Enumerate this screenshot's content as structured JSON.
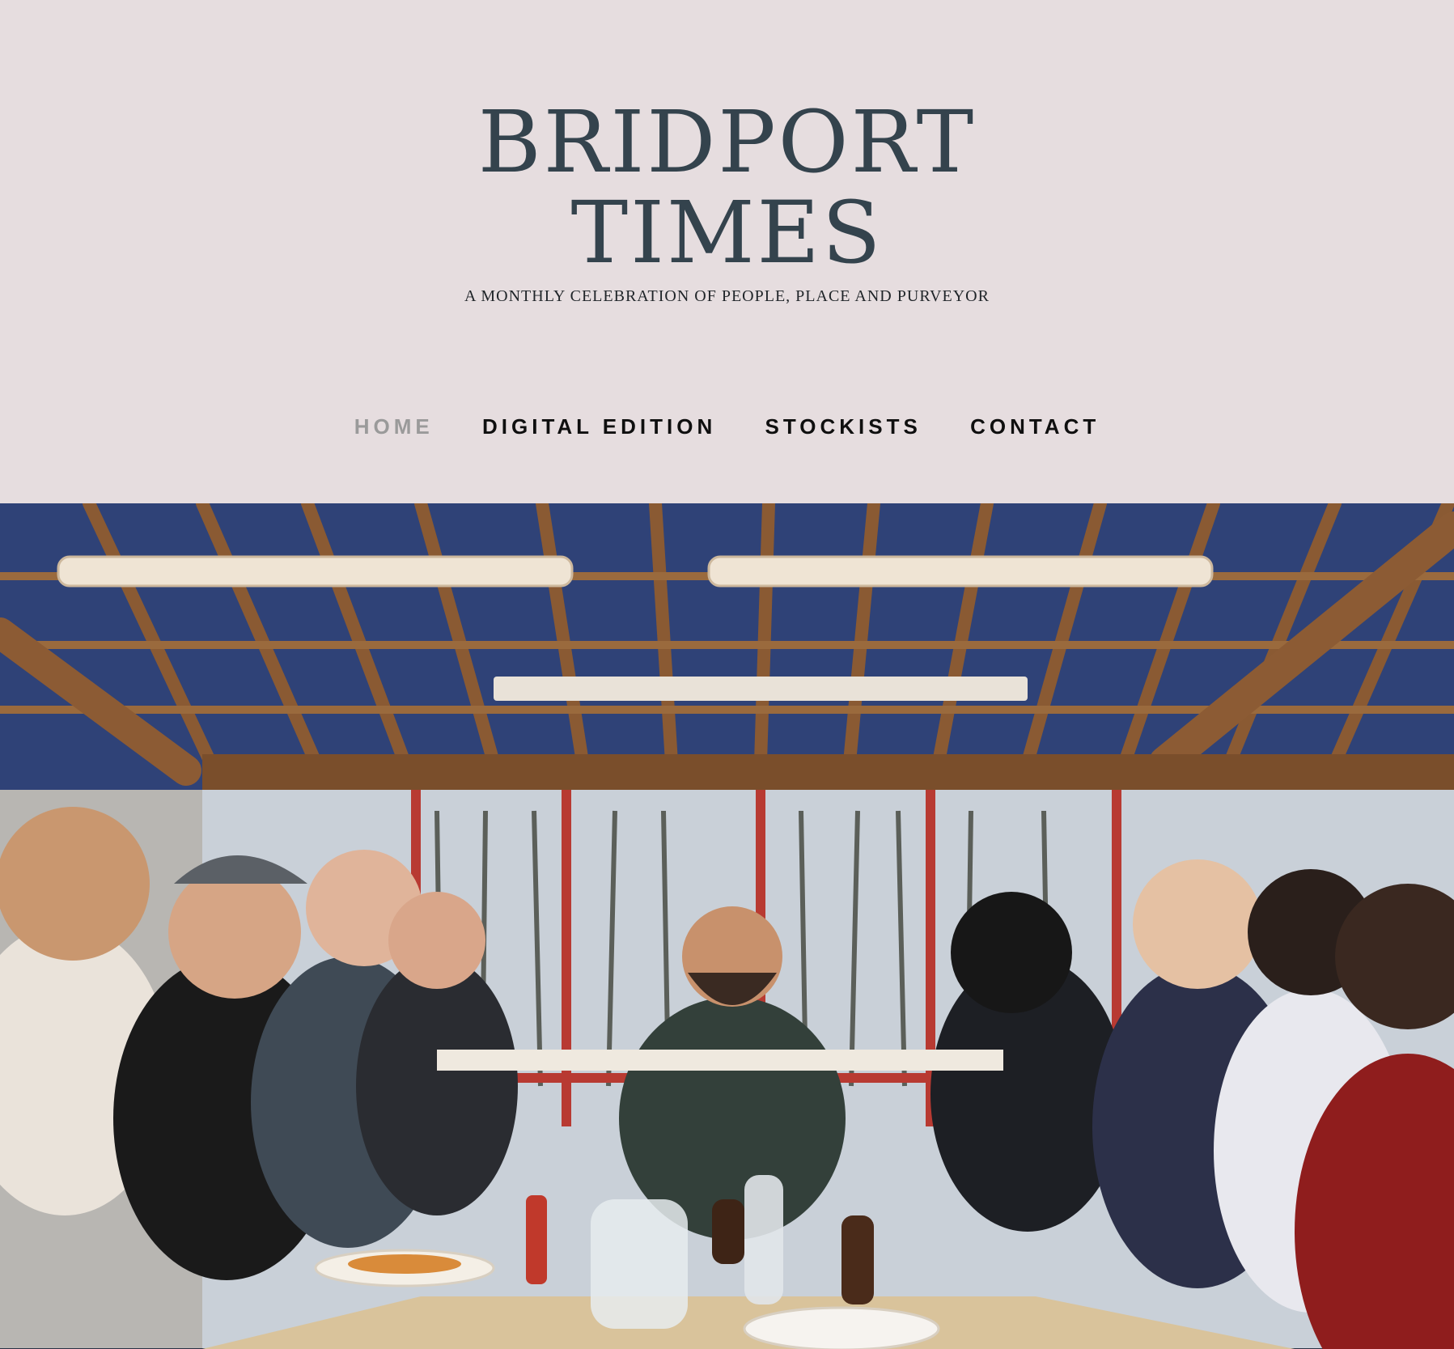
{
  "site": {
    "title_line1": "BRIDPORT",
    "title_line2": "TIMES",
    "tagline": "A MONTHLY CELEBRATION OF PEOPLE, PLACE AND PURVEYOR"
  },
  "nav": {
    "items": [
      {
        "label": "HOME",
        "active": true
      },
      {
        "label": "DIGITAL EDITION",
        "active": false
      },
      {
        "label": "STOCKISTS",
        "active": false
      },
      {
        "label": "CONTACT",
        "active": false
      }
    ]
  },
  "hero": {
    "alt": "",
    "colors": {
      "ceiling": "#2f4277",
      "beam": "#8a5a33",
      "window_frame": "#b83a32",
      "sky": "#c9d0d8",
      "table": "#d9c39b"
    }
  },
  "colors": {
    "background": "#e6dddf",
    "title": "#34434d",
    "nav_text": "#0f0f0f",
    "nav_active": "#9a9a9a"
  }
}
